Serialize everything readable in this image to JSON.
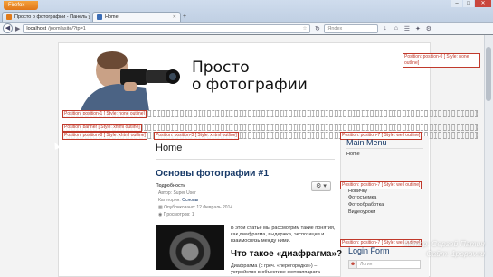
{
  "browser": {
    "app_button": "Firefox",
    "tabs": [
      {
        "label": "Просто о фотографии - Панель упр..."
      },
      {
        "label": "Home"
      }
    ],
    "url": {
      "prefix": "localhost",
      "rest": "/joomlasite/?tp=1"
    },
    "search_placeholder": "Яndex",
    "nav_icons": [
      "back-icon",
      "forward-icon",
      "star-icon",
      "reload-icon",
      "download-icon",
      "home-icon"
    ]
  },
  "site": {
    "title_line1": "Просто",
    "title_line2": "о фотографии"
  },
  "positions": {
    "p8": "Position: position-0 [ Style: none outline]",
    "p1": "Position: position-1 [ Style: none outline]",
    "banner": "Position: banner [ Style: xhtml outline]",
    "p8b": "Position: position-8 [ Style: xhtml outline]",
    "p3": "Position: position-3 [ Style: xhtml outline]",
    "p7a": "Position: position-7 [ Style: well outline]",
    "p7b": "Position: position-7 [ Style: well outline]",
    "p7c": "Position: position-7 [ Style: well outline]"
  },
  "main": {
    "heading": "Home",
    "article": {
      "title": "Основы фотографии #1",
      "details_label": "Подробности",
      "author": "Автор: Super User",
      "category_label": "Категория:",
      "category": "Основы",
      "published": "Опубликовано: 12 Февраль 2014",
      "views": "Просмотров: 1",
      "intro": "В этой статье мы рассмотрим такие понятия, как диафрагма, выдержка, экспозиция и взаимосвязь между ними.",
      "subheading": "Что такое «диафрагма»?",
      "para": "Диафрагма (с греч. «перегородка») – устройство в объективе фотоаппарата"
    }
  },
  "sidebar": {
    "menu_title": "Main Menu",
    "menu_items": [
      "Home",
      "Новичку",
      "Фотосъемка",
      "Фотообработка",
      "Видеоуроки"
    ],
    "login_title": "Login Form",
    "login_placeholder": "Логин"
  },
  "watermark": {
    "line1": "Автор: Сергей Патин",
    "line2": "Сайт: 1popov.ru"
  },
  "colors": {
    "accent": "#183a68",
    "position_outline": "#c0392b",
    "firefox_orange": "#e0771a"
  }
}
